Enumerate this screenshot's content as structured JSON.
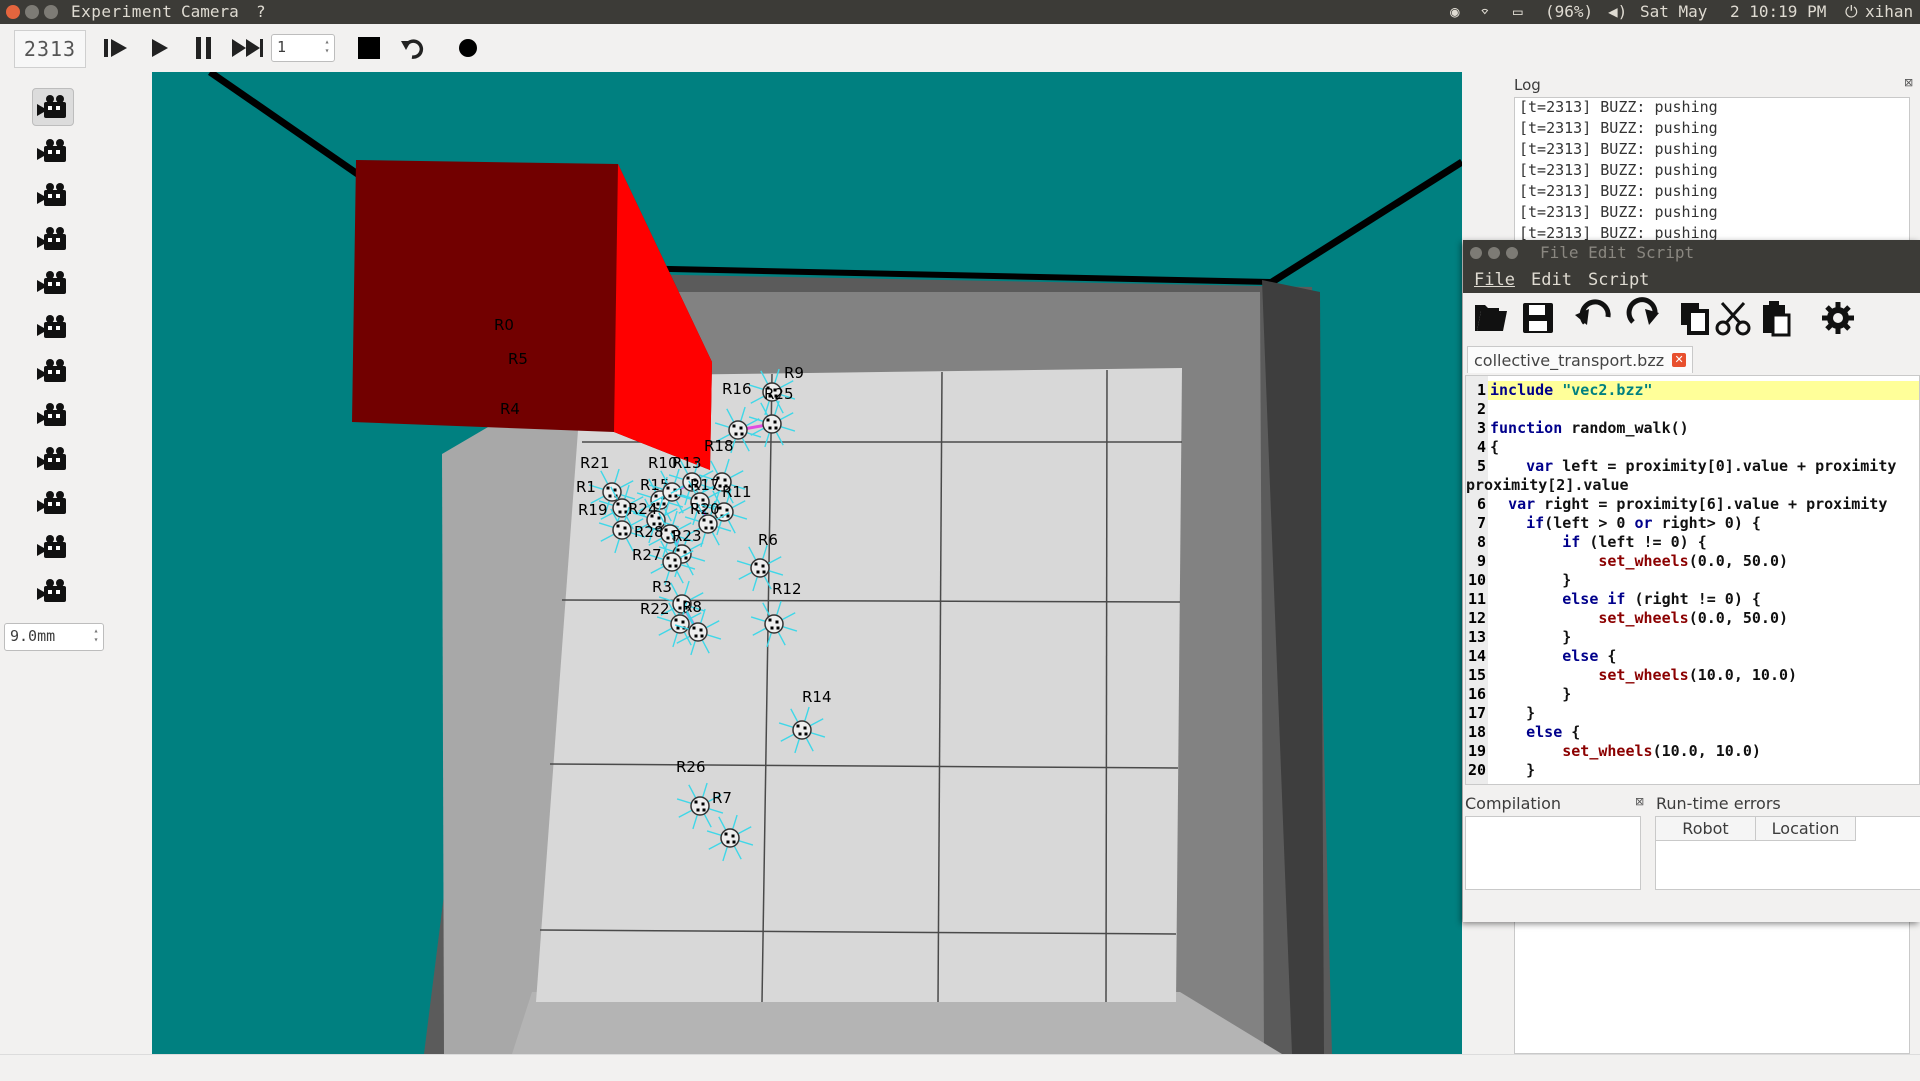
{
  "system_bar": {
    "window_title": "Experiment",
    "menu": [
      "Camera",
      "?"
    ],
    "battery": "(96%)",
    "date": "Sat May",
    "time": "2 10:19 PM",
    "user": "xihan"
  },
  "toolbar": {
    "step_counter": "2313",
    "steps_per_tick": "1",
    "buttons": [
      "step-icon",
      "play-icon",
      "pause-icon",
      "fast-forward-icon",
      "stop-icon",
      "reset-icon",
      "record-icon"
    ]
  },
  "camera_panel": {
    "cameras": 12,
    "active_index": 0,
    "focal_length": "9.0mm"
  },
  "viewport": {
    "robots": [
      {
        "id": "R0",
        "label": "R0"
      },
      {
        "id": "R5",
        "label": "R5"
      },
      {
        "id": "R4",
        "label": "R4"
      },
      {
        "id": "R9",
        "label": "R9"
      },
      {
        "id": "R16",
        "label": "R16"
      },
      {
        "id": "R25",
        "label": "R25"
      },
      {
        "id": "R18",
        "label": "R18"
      },
      {
        "id": "R21",
        "label": "R21"
      },
      {
        "id": "R1",
        "label": "R1"
      },
      {
        "id": "R15",
        "label": "R15"
      },
      {
        "id": "R10",
        "label": "R10"
      },
      {
        "id": "R13",
        "label": "R13"
      },
      {
        "id": "R17",
        "label": "R17"
      },
      {
        "id": "R11",
        "label": "R11"
      },
      {
        "id": "R19",
        "label": "R19"
      },
      {
        "id": "R24",
        "label": "R24"
      },
      {
        "id": "R20",
        "label": "R20"
      },
      {
        "id": "R28",
        "label": "R28"
      },
      {
        "id": "R23",
        "label": "R23"
      },
      {
        "id": "R6",
        "label": "R6"
      },
      {
        "id": "R27",
        "label": "R27"
      },
      {
        "id": "R3",
        "label": "R3"
      },
      {
        "id": "R12",
        "label": "R12"
      },
      {
        "id": "R22",
        "label": "R22"
      },
      {
        "id": "R8",
        "label": "R8"
      },
      {
        "id": "R14",
        "label": "R14"
      },
      {
        "id": "R26",
        "label": "R26"
      },
      {
        "id": "R7",
        "label": "R7"
      }
    ],
    "colors": {
      "background": "#008080",
      "object_dark": "#720000",
      "object_light": "#ff0000",
      "floor": "#d8d8d8",
      "wall": "#5a5a5a"
    }
  },
  "log": {
    "title": "Log",
    "lines": [
      "[t=2313] BUZZ: pushing",
      "[t=2313] BUZZ: pushing",
      "[t=2313] BUZZ: pushing",
      "[t=2313] BUZZ: pushing",
      "[t=2313] BUZZ: pushing",
      "[t=2313] BUZZ: pushing",
      "[t=2313] BUZZ: pushing"
    ]
  },
  "editor": {
    "title": "File Edit Script",
    "menu": {
      "file": "File",
      "edit": "Edit",
      "script": "Script"
    },
    "tab": "collective_transport.bzz",
    "code_lines": [
      {
        "n": "1",
        "text": "include \"vec2.bzz\""
      },
      {
        "n": "2",
        "text": ""
      },
      {
        "n": "3",
        "text": "function random_walk()"
      },
      {
        "n": "4",
        "text": "{"
      },
      {
        "n": "5",
        "text": "    var left = proximity[0].value + proximity"
      },
      {
        "n": "",
        "text": "proximity[2].value"
      },
      {
        "n": "6",
        "text": "  var right = proximity[6].value + proximity"
      },
      {
        "n": "7",
        "text": "    if(left > 0 or right> 0) {"
      },
      {
        "n": "8",
        "text": "        if (left != 0) {"
      },
      {
        "n": "9",
        "text": "            set_wheels(0.0, 50.0)"
      },
      {
        "n": "10",
        "text": "        }"
      },
      {
        "n": "11",
        "text": "        else if (right != 0) {"
      },
      {
        "n": "12",
        "text": "            set_wheels(0.0, 50.0)"
      },
      {
        "n": "13",
        "text": "        }"
      },
      {
        "n": "14",
        "text": "        else {"
      },
      {
        "n": "15",
        "text": "            set_wheels(10.0, 10.0)"
      },
      {
        "n": "16",
        "text": "        }"
      },
      {
        "n": "17",
        "text": "    }"
      },
      {
        "n": "18",
        "text": "    else {"
      },
      {
        "n": "19",
        "text": "        set_wheels(10.0, 10.0)"
      },
      {
        "n": "20",
        "text": "    }"
      }
    ],
    "compilation_title": "Compilation",
    "runtime_title": "Run-time errors",
    "runtime_columns": [
      "Robot",
      "Location"
    ]
  }
}
